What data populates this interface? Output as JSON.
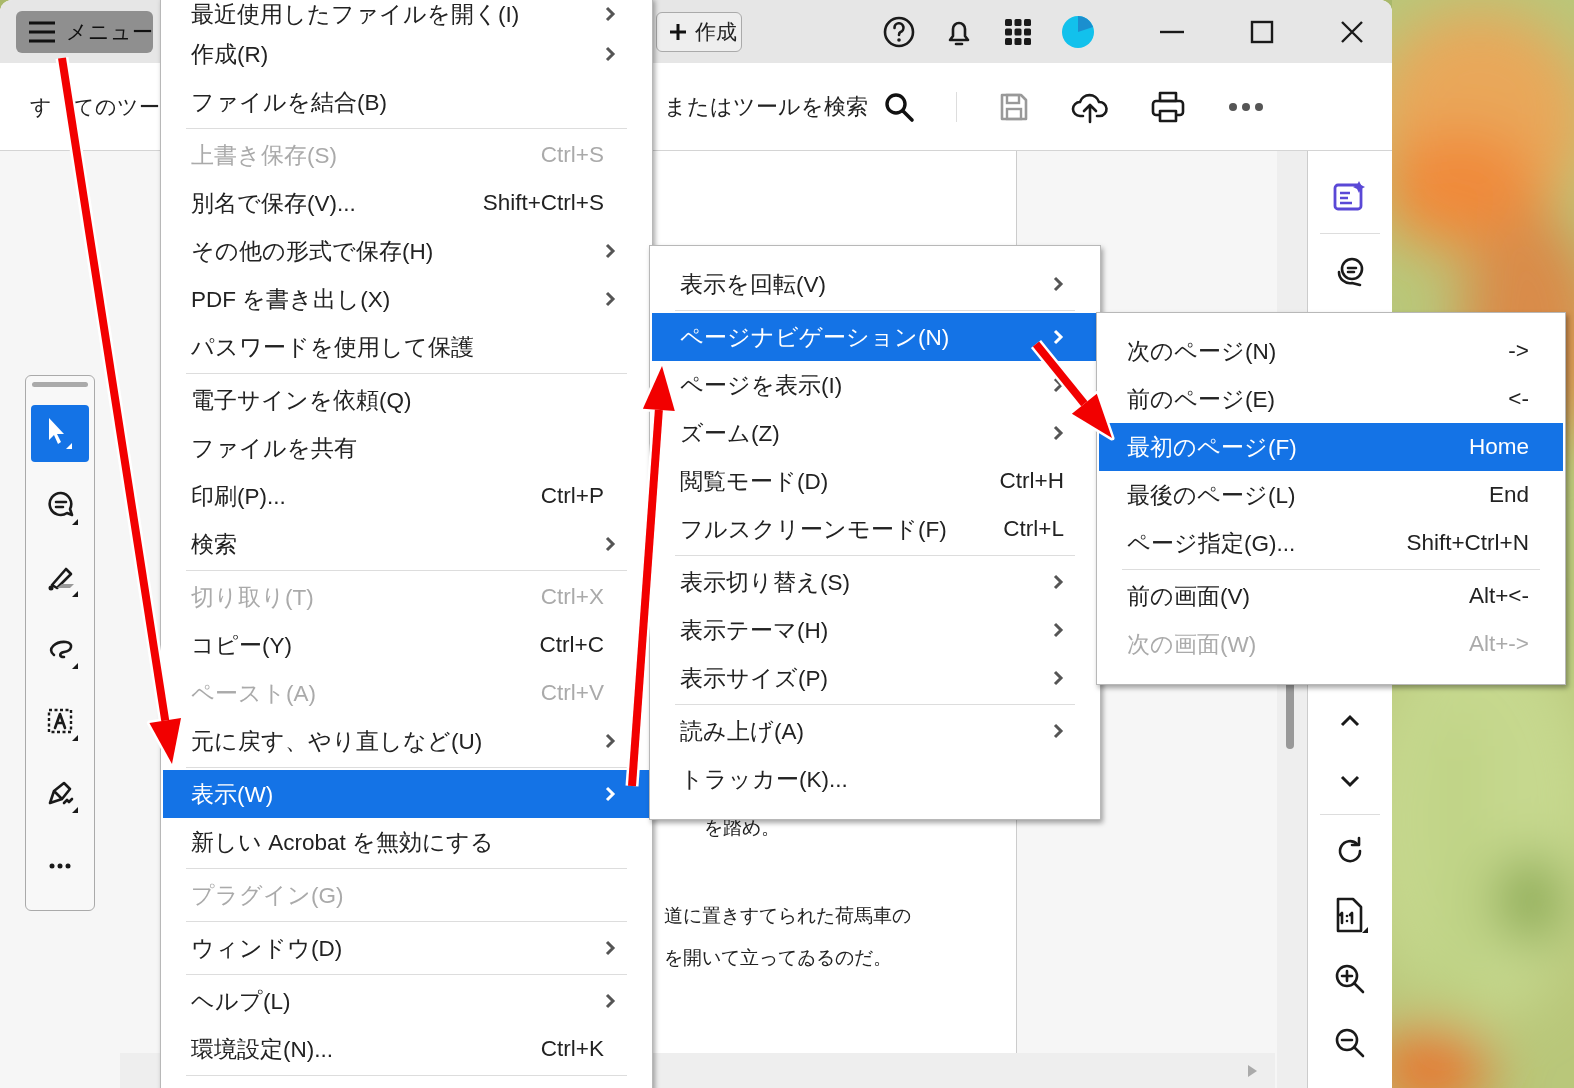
{
  "title_bar": {
    "menu_button": "メニュー",
    "create_button": "作成"
  },
  "toolbar": {
    "all_tools": "す　てのツー",
    "search_placeholder": "またはツールを検索"
  },
  "left_tools": [
    {
      "kind": "select",
      "selected": true
    },
    {
      "kind": "comment",
      "selected": false
    },
    {
      "kind": "highlight",
      "selected": false
    },
    {
      "kind": "draw",
      "selected": false
    },
    {
      "kind": "text",
      "selected": false
    },
    {
      "kind": "sign",
      "selected": false
    },
    {
      "kind": "more",
      "selected": false
    }
  ],
  "document": {
    "lines": [
      "を踏め。",
      "道に置きすてられた荷馬車の",
      "を開いて立ってゐるのだ。"
    ]
  },
  "main_menu": {
    "items": [
      {
        "kind": "item",
        "label": "最近使用したファイルを開く(I)",
        "submenu": true,
        "disabled": false,
        "selected": false
      },
      {
        "kind": "item",
        "label": "作成(R)",
        "submenu": true,
        "disabled": false,
        "selected": false
      },
      {
        "kind": "item",
        "label": "ファイルを結合(B)",
        "submenu": false,
        "disabled": false,
        "selected": false
      },
      {
        "kind": "separator"
      },
      {
        "kind": "item",
        "label": "上書き保存(S)",
        "shortcut": "Ctrl+S",
        "submenu": false,
        "disabled": true,
        "selected": false
      },
      {
        "kind": "item",
        "label": "別名で保存(V)...",
        "shortcut": "Shift+Ctrl+S",
        "submenu": false,
        "disabled": false,
        "selected": false
      },
      {
        "kind": "item",
        "label": "その他の形式で保存(H)",
        "submenu": true,
        "disabled": false,
        "selected": false
      },
      {
        "kind": "item",
        "label": "PDF を書き出し(X)",
        "submenu": true,
        "disabled": false,
        "selected": false
      },
      {
        "kind": "item",
        "label": "パスワードを使用して保護",
        "submenu": false,
        "disabled": false,
        "selected": false
      },
      {
        "kind": "separator"
      },
      {
        "kind": "item",
        "label": "電子サインを依頼(Q)",
        "submenu": false,
        "disabled": false,
        "selected": false
      },
      {
        "kind": "item",
        "label": "ファイルを共有",
        "submenu": false,
        "disabled": false,
        "selected": false
      },
      {
        "kind": "item",
        "label": "印刷(P)...",
        "shortcut": "Ctrl+P",
        "submenu": false,
        "disabled": false,
        "selected": false
      },
      {
        "kind": "item",
        "label": "検索",
        "submenu": true,
        "disabled": false,
        "selected": false
      },
      {
        "kind": "separator"
      },
      {
        "kind": "item",
        "label": "切り取り(T)",
        "shortcut": "Ctrl+X",
        "submenu": false,
        "disabled": true,
        "selected": false
      },
      {
        "kind": "item",
        "label": "コピー(Y)",
        "shortcut": "Ctrl+C",
        "submenu": false,
        "disabled": false,
        "selected": false
      },
      {
        "kind": "item",
        "label": "ペースト(A)",
        "shortcut": "Ctrl+V",
        "submenu": false,
        "disabled": true,
        "selected": false
      },
      {
        "kind": "item",
        "label": "元に戻す、やり直しなど(U)",
        "submenu": true,
        "disabled": false,
        "selected": false
      },
      {
        "kind": "separator"
      },
      {
        "kind": "item",
        "label": "表示(W)",
        "submenu": true,
        "disabled": false,
        "selected": true
      },
      {
        "kind": "item",
        "label": "新しい Acrobat を無効にする",
        "submenu": false,
        "disabled": false,
        "selected": false
      },
      {
        "kind": "separator"
      },
      {
        "kind": "item",
        "label": "プラグイン(G)",
        "submenu": false,
        "disabled": true,
        "selected": false
      },
      {
        "kind": "separator"
      },
      {
        "kind": "item",
        "label": "ウィンドウ(D)",
        "submenu": true,
        "disabled": false,
        "selected": false
      },
      {
        "kind": "separator"
      },
      {
        "kind": "item",
        "label": "ヘルプ(L)",
        "submenu": true,
        "disabled": false,
        "selected": false
      },
      {
        "kind": "item",
        "label": "環境設定(N)...",
        "shortcut": "Ctrl+K",
        "submenu": false,
        "disabled": false,
        "selected": false
      },
      {
        "kind": "separator"
      }
    ]
  },
  "view_submenu": {
    "items": [
      {
        "kind": "item",
        "label": "表示を回転(V)",
        "submenu": true,
        "disabled": false,
        "selected": false
      },
      {
        "kind": "separator"
      },
      {
        "kind": "item",
        "label": "ページナビゲーション(N)",
        "submenu": true,
        "disabled": false,
        "selected": true
      },
      {
        "kind": "item",
        "label": "ページを表示(I)",
        "submenu": true,
        "disabled": false,
        "selected": false
      },
      {
        "kind": "item",
        "label": "ズーム(Z)",
        "submenu": true,
        "disabled": false,
        "selected": false
      },
      {
        "kind": "item",
        "label": "閲覧モード(D)",
        "shortcut": "Ctrl+H",
        "submenu": false,
        "disabled": false,
        "selected": false
      },
      {
        "kind": "item",
        "label": "フルスクリーンモード(F)",
        "shortcut": "Ctrl+L",
        "submenu": false,
        "disabled": false,
        "selected": false
      },
      {
        "kind": "separator"
      },
      {
        "kind": "item",
        "label": "表示切り替え(S)",
        "submenu": true,
        "disabled": false,
        "selected": false
      },
      {
        "kind": "item",
        "label": "表示テーマ(H)",
        "submenu": true,
        "disabled": false,
        "selected": false
      },
      {
        "kind": "item",
        "label": "表示サイズ(P)",
        "submenu": true,
        "disabled": false,
        "selected": false
      },
      {
        "kind": "separator"
      },
      {
        "kind": "item",
        "label": "読み上げ(A)",
        "submenu": true,
        "disabled": false,
        "selected": false
      },
      {
        "kind": "item",
        "label": "トラッカー(K)...",
        "submenu": false,
        "disabled": false,
        "selected": false
      }
    ]
  },
  "page_navigation_submenu": {
    "items": [
      {
        "kind": "item",
        "label": "次のページ(N)",
        "shortcut": "->",
        "submenu": false,
        "disabled": false,
        "selected": false
      },
      {
        "kind": "item",
        "label": "前のページ(E)",
        "shortcut": "<-",
        "submenu": false,
        "disabled": false,
        "selected": false
      },
      {
        "kind": "item",
        "label": "最初のページ(F)",
        "shortcut": "Home",
        "submenu": false,
        "disabled": false,
        "selected": true
      },
      {
        "kind": "item",
        "label": "最後のページ(L)",
        "shortcut": "End",
        "submenu": false,
        "disabled": false,
        "selected": false
      },
      {
        "kind": "item",
        "label": "ページ指定(G)...",
        "shortcut": "Shift+Ctrl+N",
        "submenu": false,
        "disabled": false,
        "selected": false
      },
      {
        "kind": "separator"
      },
      {
        "kind": "item",
        "label": "前の画面(V)",
        "shortcut": "Alt+<-",
        "submenu": false,
        "disabled": false,
        "selected": false
      },
      {
        "kind": "item",
        "label": "次の画面(W)",
        "shortcut": "Alt+->",
        "submenu": false,
        "disabled": true,
        "selected": false
      }
    ]
  }
}
